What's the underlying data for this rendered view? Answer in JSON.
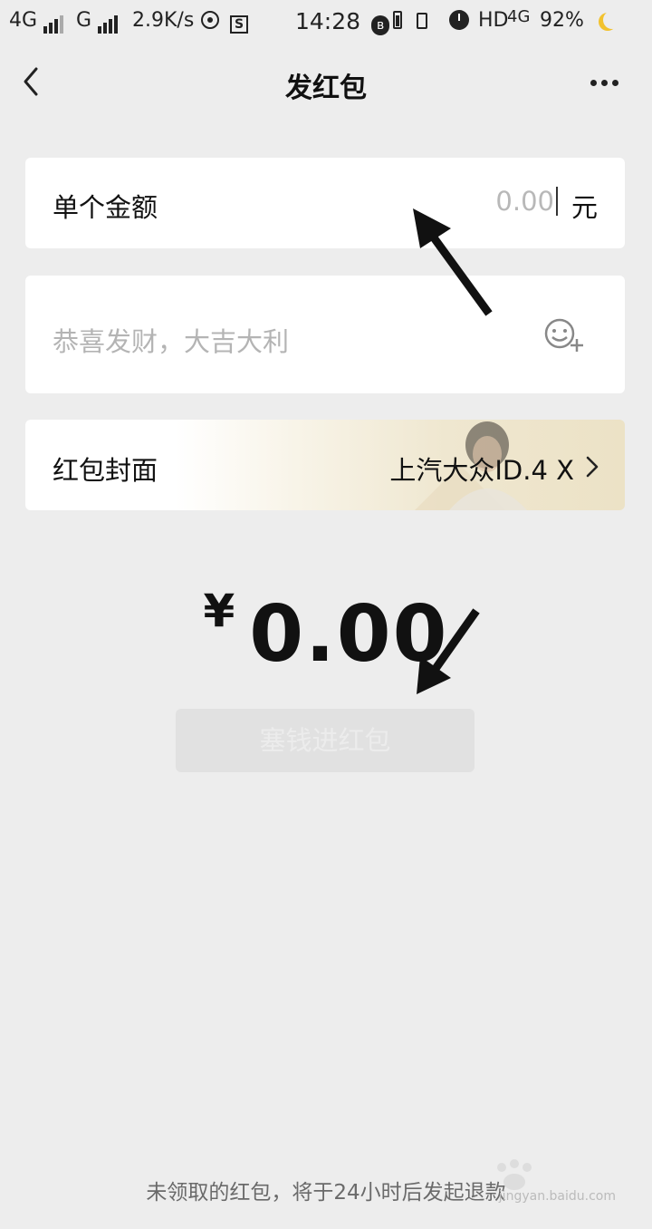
{
  "status_bar": {
    "net1": "4G",
    "net2": "G",
    "speed": "2.9K/s",
    "s_icon_letter": "S",
    "time": "14:28",
    "bt_glyph": "ʙ",
    "hd": "HD",
    "net3": "4G",
    "battery": "92%"
  },
  "header": {
    "title": "发红包"
  },
  "amount": {
    "label": "单个金额",
    "value_placeholder": "0.00",
    "unit": "元"
  },
  "message": {
    "placeholder": "恭喜发财，大吉大利"
  },
  "cover": {
    "label": "红包封面",
    "name": "上汽大众ID.4 X"
  },
  "total": {
    "currency": "¥",
    "value": "0.00"
  },
  "send_button": {
    "label": "塞钱进红包"
  },
  "footnote": "未领取的红包，将于24小时后发起退款",
  "watermark": {
    "text": "jingyan.baidu.com"
  },
  "colors": {
    "background": "#ededed",
    "card": "#ffffff",
    "disabled_button": "#e1e1e1",
    "battery_moon": "#f2c22e"
  }
}
